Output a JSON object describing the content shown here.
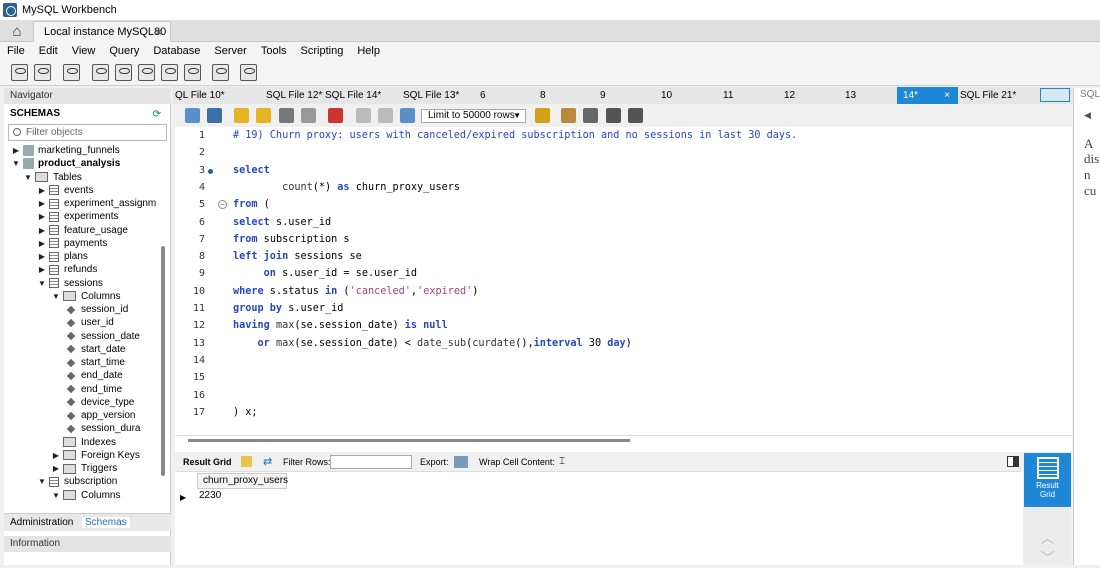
{
  "app": {
    "title": "MySQL Workbench"
  },
  "connection_tab": {
    "label": "Local instance MySQL80",
    "close": "×"
  },
  "menu": [
    "File",
    "Edit",
    "View",
    "Query",
    "Database",
    "Server",
    "Tools",
    "Scripting",
    "Help"
  ],
  "navigator": {
    "header": "Navigator",
    "schemas_label": "SCHEMAS",
    "filter_placeholder": "Filter objects",
    "tree": [
      {
        "label": "marketing_funnels",
        "level": 0,
        "arrow": "▶",
        "kind": "db"
      },
      {
        "label": "product_analysis",
        "level": 0,
        "arrow": "▼",
        "kind": "db",
        "bold": true
      },
      {
        "label": "Tables",
        "level": 1,
        "arrow": "▼",
        "kind": "fld"
      },
      {
        "label": "events",
        "level": 2,
        "arrow": "▶",
        "kind": "tbl"
      },
      {
        "label": "experiment_assignm",
        "level": 2,
        "arrow": "▶",
        "kind": "tbl"
      },
      {
        "label": "experiments",
        "level": 2,
        "arrow": "▶",
        "kind": "tbl"
      },
      {
        "label": "feature_usage",
        "level": 2,
        "arrow": "▶",
        "kind": "tbl"
      },
      {
        "label": "payments",
        "level": 2,
        "arrow": "▶",
        "kind": "tbl"
      },
      {
        "label": "plans",
        "level": 2,
        "arrow": "▶",
        "kind": "tbl"
      },
      {
        "label": "refunds",
        "level": 2,
        "arrow": "▶",
        "kind": "tbl"
      },
      {
        "label": "sessions",
        "level": 2,
        "arrow": "▼",
        "kind": "tbl"
      },
      {
        "label": "Columns",
        "level": 3,
        "arrow": "▼",
        "kind": "fld"
      },
      {
        "label": "session_id",
        "level": 4,
        "arrow": "",
        "kind": "col"
      },
      {
        "label": "user_id",
        "level": 4,
        "arrow": "",
        "kind": "col"
      },
      {
        "label": "session_date",
        "level": 4,
        "arrow": "",
        "kind": "col"
      },
      {
        "label": "start_date",
        "level": 4,
        "arrow": "",
        "kind": "col"
      },
      {
        "label": "start_time",
        "level": 4,
        "arrow": "",
        "kind": "col"
      },
      {
        "label": "end_date",
        "level": 4,
        "arrow": "",
        "kind": "col"
      },
      {
        "label": "end_time",
        "level": 4,
        "arrow": "",
        "kind": "col"
      },
      {
        "label": "device_type",
        "level": 4,
        "arrow": "",
        "kind": "col"
      },
      {
        "label": "app_version",
        "level": 4,
        "arrow": "",
        "kind": "col"
      },
      {
        "label": "session_dura",
        "level": 4,
        "arrow": "",
        "kind": "col"
      },
      {
        "label": "Indexes",
        "level": 3,
        "arrow": "",
        "kind": "fld"
      },
      {
        "label": "Foreign Keys",
        "level": 3,
        "arrow": "▶",
        "kind": "fld"
      },
      {
        "label": "Triggers",
        "level": 3,
        "arrow": "▶",
        "kind": "fld"
      },
      {
        "label": "subscription",
        "level": 2,
        "arrow": "▼",
        "kind": "tbl"
      },
      {
        "label": "Columns",
        "level": 3,
        "arrow": "▼",
        "kind": "fld"
      }
    ],
    "tabs": {
      "administration": "Administration",
      "schemas": "Schemas"
    },
    "info_header": "Information"
  },
  "editor_tabs": [
    "QL File 10*",
    "SQL File 12*",
    "SQL File 14*",
    "SQL File 13*",
    "6",
    "8",
    "9",
    "10",
    "11",
    "12",
    "13",
    "14*",
    "SQL File 21*"
  ],
  "active_tab_close": "×",
  "limit_rows": "Limit to 50000 rows",
  "code_lines": [
    {
      "n": "1",
      "html": "<span class='cm'># 19) Churn proxy: users with canceled/expired subscription and no sessions in last 30 days.</span>"
    },
    {
      "n": "2",
      "html": ""
    },
    {
      "n": "3",
      "html": "<span class='kw'>select</span>",
      "dot": true
    },
    {
      "n": "4",
      "html": "        <span class='fn'>count</span>(*) <span class='kw'>as</span> churn_proxy_users"
    },
    {
      "n": "5",
      "html": "<span class='kw'>from</span> (",
      "fold": true
    },
    {
      "n": "6",
      "html": "<span class='kw'>select</span> s.user_id"
    },
    {
      "n": "7",
      "html": "<span class='kw'>from</span> subscription s"
    },
    {
      "n": "8",
      "html": "<span class='kw'>left join</span> sessions se"
    },
    {
      "n": "9",
      "html": "     <span class='kw'>on</span> s.user_id = se.user_id"
    },
    {
      "n": "10",
      "html": "<span class='kw'>where</span> s.status <span class='kw'>in</span> (<span class='st'>'canceled'</span>,<span class='st'>'expired'</span>)"
    },
    {
      "n": "11",
      "html": "<span class='kw'>group by</span> s.user_id"
    },
    {
      "n": "12",
      "html": "<span class='kw'>having</span> <span class='fn'>max</span>(se.session_date) <span class='kw'>is null</span>"
    },
    {
      "n": "13",
      "html": "    <span class='kw'>or</span> <span class='fn'>max</span>(se.session_date) &lt; <span class='fn'>date_sub</span>(<span class='fn'>curdate</span>(),<span class='kw'>interval</span> 30 <span class='kw'>day</span>)"
    },
    {
      "n": "14",
      "html": ""
    },
    {
      "n": "15",
      "html": ""
    },
    {
      "n": "16",
      "html": ""
    },
    {
      "n": "17",
      "html": ") x;"
    }
  ],
  "results": {
    "result_grid_label": "Result Grid",
    "filter_rows_label": "Filter Rows:",
    "export_label": "Export:",
    "wrap_label": "Wrap Cell Content:",
    "columns": [
      "churn_proxy_users"
    ],
    "rows": [
      [
        "2230"
      ]
    ],
    "side_button": "Result Grid"
  },
  "right_panel": {
    "header": "SQL",
    "text": [
      "A",
      "dis",
      "n",
      "cu"
    ]
  },
  "colors": {
    "accent": "#1e88d6",
    "keyword": "#2546c4",
    "string": "#a3408e"
  }
}
